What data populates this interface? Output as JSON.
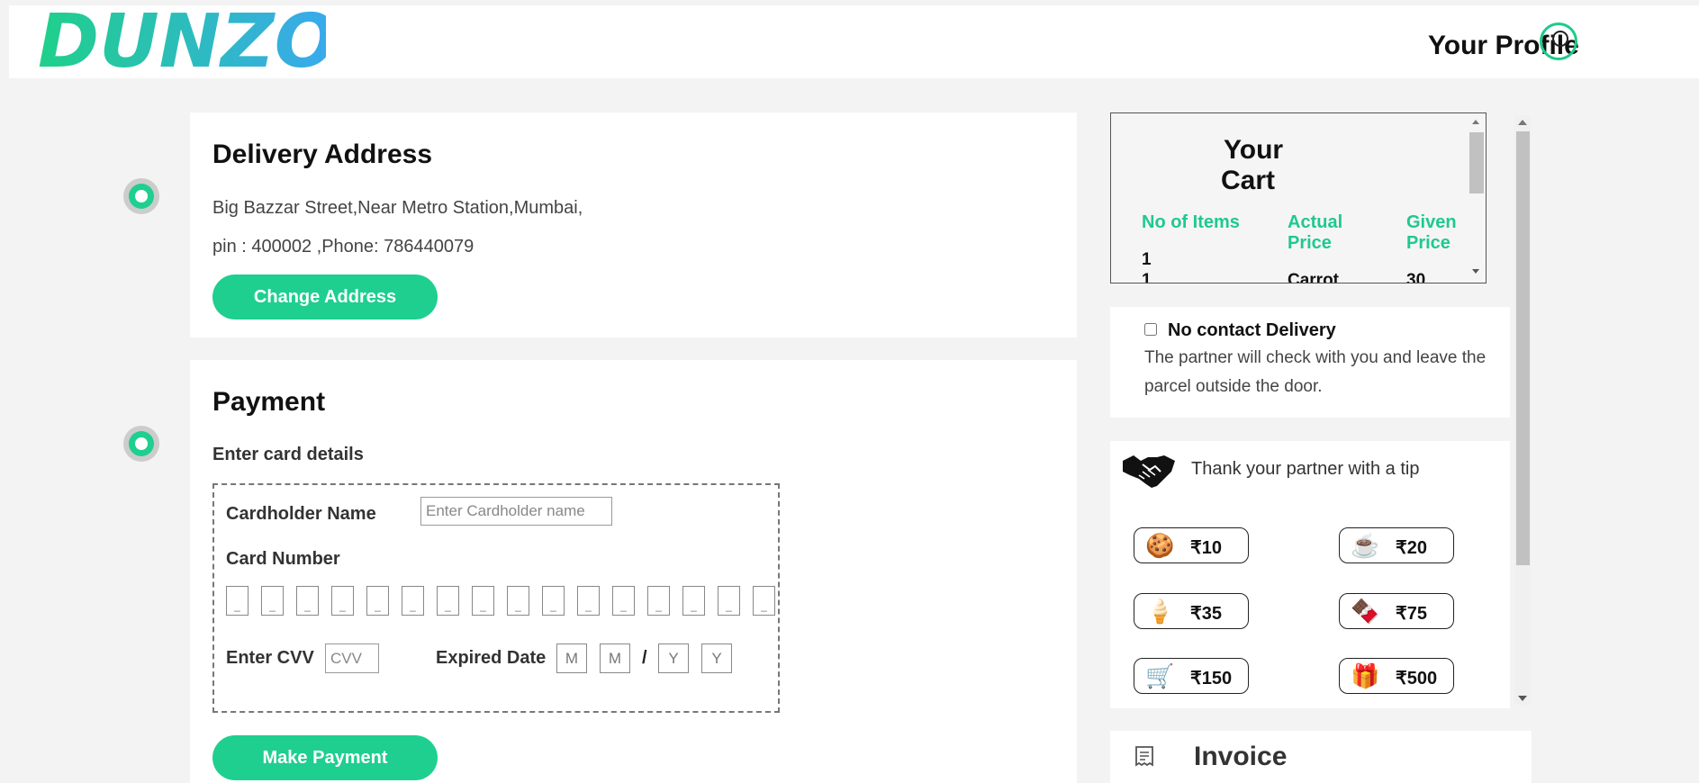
{
  "header": {
    "logo": "DUNZO",
    "profile_label": "Your Profile"
  },
  "delivery": {
    "title": "Delivery Address",
    "line1": "Big Bazzar Street,Near Metro Station,Mumbai,",
    "line2": "pin : 400002 ,Phone: 786440079",
    "change_button": "Change Address"
  },
  "payment": {
    "title": "Payment",
    "subtitle": "Enter card details",
    "cardholder_label": "Cardholder Name",
    "cardholder_placeholder": "Enter Cardholder name",
    "card_number_label": "Card Number",
    "digit_placeholder": "_",
    "cvv_label": "Enter CVV",
    "cvv_placeholder": "CVV",
    "expiry_label": "Expired Date",
    "expiry": {
      "m1": "M",
      "m2": "M",
      "sep": "/",
      "y1": "Y",
      "y2": "Y"
    },
    "pay_button": "Make Payment"
  },
  "cart": {
    "title_line1": "Your",
    "title_line2": "Cart",
    "columns": {
      "items": "No of Items",
      "actual": "Actual Price",
      "given": "Given Price"
    },
    "count_value": "1",
    "row": {
      "qty": "1",
      "name": "Carrot",
      "price": "30"
    }
  },
  "no_contact": {
    "label": "No contact Delivery",
    "description": "The partner will check with you and leave the parcel outside the door."
  },
  "tip": {
    "prompt": "Thank your partner with a tip",
    "options": [
      {
        "icon": "cookie-icon",
        "glyph": "🍪",
        "amount": "₹10"
      },
      {
        "icon": "coffee-icon",
        "glyph": "☕",
        "amount": "₹20"
      },
      {
        "icon": "ice-cream-icon",
        "glyph": "🍦",
        "amount": "₹35"
      },
      {
        "icon": "chocolate-icon",
        "glyph": "🍫",
        "amount": "₹75"
      },
      {
        "icon": "cart-icon",
        "glyph": "🛒",
        "amount": "₹150"
      },
      {
        "icon": "gift-icon",
        "glyph": "🎁",
        "amount": "₹500"
      }
    ]
  },
  "invoice": {
    "title": "Invoice"
  },
  "colors": {
    "accent": "#1fcf8f",
    "logo_start": "#1fd08a",
    "logo_end": "#3aa8f0"
  }
}
